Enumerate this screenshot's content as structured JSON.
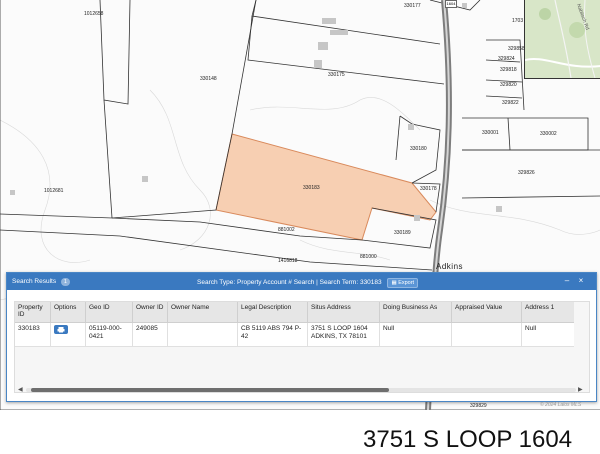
{
  "map": {
    "parcels": [
      {
        "id": "p1",
        "text": "1012658"
      },
      {
        "id": "p2",
        "text": "330148"
      },
      {
        "id": "p3",
        "text": "1012681"
      },
      {
        "id": "p4",
        "text": "330175"
      },
      {
        "id": "p5",
        "text": "330177"
      },
      {
        "id": "p6",
        "text": "330180"
      },
      {
        "id": "p7",
        "text": "330183"
      },
      {
        "id": "p8",
        "text": "330178"
      },
      {
        "id": "p9",
        "text": "330189"
      },
      {
        "id": "p10",
        "text": "881002"
      },
      {
        "id": "p11",
        "text": "881000"
      },
      {
        "id": "p12",
        "text": "1416818"
      },
      {
        "id": "p13",
        "text": "330001"
      },
      {
        "id": "p14",
        "text": "330002"
      },
      {
        "id": "p15",
        "text": "329826"
      },
      {
        "id": "p16",
        "text": "329858"
      },
      {
        "id": "p17",
        "text": "329818"
      },
      {
        "id": "p18",
        "text": "329820"
      },
      {
        "id": "p19",
        "text": "329822"
      },
      {
        "id": "p20",
        "text": "329824"
      },
      {
        "id": "p21",
        "text": "1703"
      },
      {
        "id": "p22",
        "text": "329829"
      }
    ],
    "road_shield": "1604",
    "town_label": "Adkins",
    "minimap_label": "Nabitsch Rd"
  },
  "panel": {
    "title": "Search Results",
    "count": "1",
    "search_info": "Search Type: Property Account # Search | Search Term: 330183",
    "export_label": "Export",
    "minimize_label": "–",
    "close_label": "×",
    "columns": [
      "Property ID",
      "Options",
      "Geo ID",
      "Owner ID",
      "Owner Name",
      "Legal Description",
      "Situs Address",
      "Doing Business As",
      "Appraised Value",
      "Address 1"
    ],
    "rows": [
      {
        "property_id": "330183",
        "geo_id": "05119-000-0421",
        "owner_id": "249085",
        "owner_name": "",
        "legal_description": "CB 5119 ABS 794 P-42",
        "situs_address": "3751 S LOOP 1604 ADKINS, TX 78101",
        "doing_business_as": "Null",
        "appraised_value": "",
        "address_1": "Null"
      }
    ]
  },
  "footer": {
    "address_title": "3751 S LOOP 1604",
    "watermark": "© 2024 Lalos MLS"
  }
}
